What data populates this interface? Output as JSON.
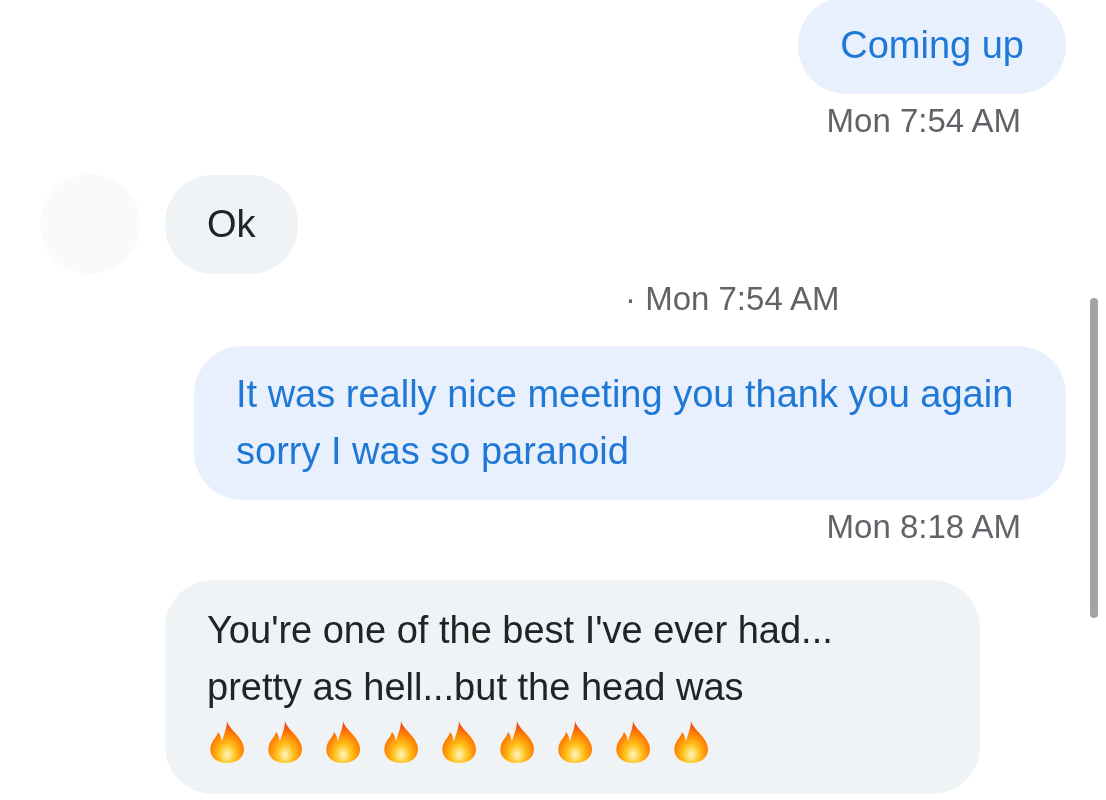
{
  "messages": [
    {
      "kind": "outgoing",
      "text": "Coming up",
      "timestamp": "Mon 7:54 AM"
    },
    {
      "kind": "incoming",
      "text": "Ok",
      "meta": "· Mon 7:54 AM"
    },
    {
      "kind": "outgoing",
      "text": "It was really nice meeting you thank you again sorry I was so paranoid",
      "timestamp": "Mon 8:18 AM"
    },
    {
      "kind": "incoming",
      "text": "You're one of the best I've ever had... pretty as hell...but the head was",
      "emoji": [
        {
          "kind": "fire"
        },
        {
          "kind": "fire"
        },
        {
          "kind": "fire"
        },
        {
          "kind": "fire"
        },
        {
          "kind": "fire"
        },
        {
          "kind": "fire"
        },
        {
          "kind": "fire"
        },
        {
          "kind": "fire"
        },
        {
          "kind": "fire"
        }
      ]
    }
  ]
}
